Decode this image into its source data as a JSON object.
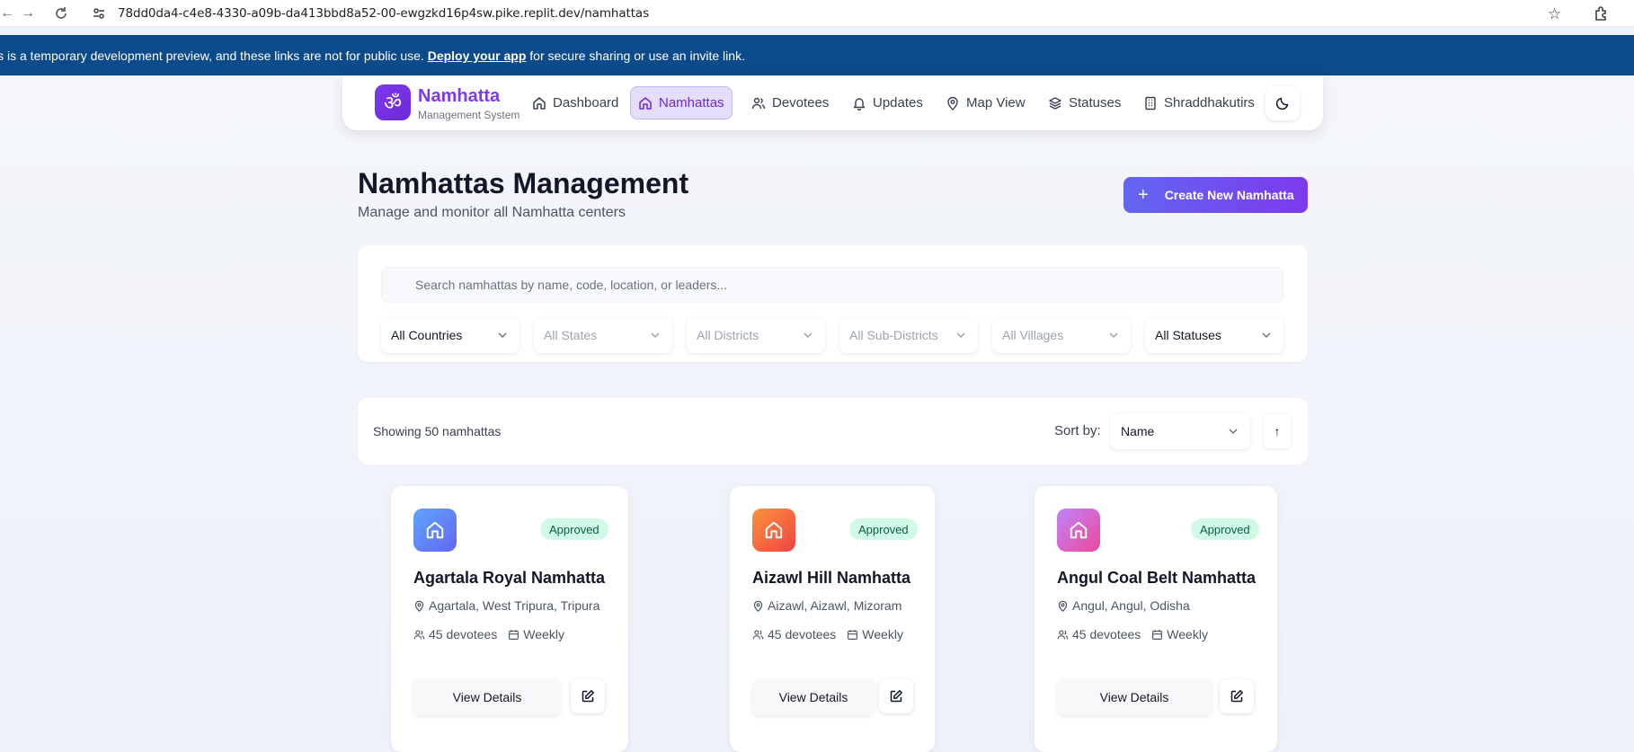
{
  "browser": {
    "url": "78dd0da4-c4e8-4330-a09b-da413bbd8a52-00-ewgzkd16p4sw.pike.replit.dev/namhattas"
  },
  "banner": {
    "text": "is is a temporary development preview, and these links are not for public use.",
    "link": "Deploy your app",
    "suffix": "for secure sharing or use an invite link."
  },
  "brand": {
    "logo_glyph": "ॐ",
    "title": "Namhatta",
    "subtitle": "Management System",
    "accent_color": "#7c3aed"
  },
  "nav": {
    "items": [
      {
        "label": "Dashboard",
        "icon": "home-icon"
      },
      {
        "label": "Namhattas",
        "icon": "home-icon",
        "active": true
      },
      {
        "label": "Devotees",
        "icon": "users-icon"
      },
      {
        "label": "Updates",
        "icon": "bell-icon"
      },
      {
        "label": "Map View",
        "icon": "map-pin-icon"
      },
      {
        "label": "Statuses",
        "icon": "layers-icon"
      },
      {
        "label": "Shraddhakutirs",
        "icon": "building-icon"
      }
    ],
    "theme_toggle_icon": "moon-icon"
  },
  "page": {
    "title": "Namhattas Management",
    "subtitle": "Manage and monitor all Namhatta centers",
    "create_button": "Create New Namhatta"
  },
  "filters": {
    "search_placeholder": "Search namhattas by name, code, location, or leaders...",
    "selects": [
      {
        "label": "All Countries",
        "enabled": true
      },
      {
        "label": "All States",
        "enabled": false
      },
      {
        "label": "All Districts",
        "enabled": false
      },
      {
        "label": "All Sub-Districts",
        "enabled": false
      },
      {
        "label": "All Villages",
        "enabled": false
      },
      {
        "label": "All Statuses",
        "enabled": true
      }
    ]
  },
  "results": {
    "count_text": "Showing 50 namhattas",
    "sort_label": "Sort by:",
    "sort_value": "Name",
    "sort_direction": "↑"
  },
  "cards": [
    {
      "name": "Agartala Royal Namhatta",
      "status": "Approved",
      "location": "Agartala, West Tripura, Tripura",
      "devotees": "45 devotees",
      "frequency": "Weekly",
      "view_label": "View Details",
      "icon_gradient": [
        "#60a5fa",
        "#6366f1"
      ]
    },
    {
      "name": "Aizawl Hill Namhatta",
      "status": "Approved",
      "location": "Aizawl, Aizawl, Mizoram",
      "devotees": "45 devotees",
      "frequency": "Weekly",
      "view_label": "View Details",
      "icon_gradient": [
        "#fb923c",
        "#ef4444"
      ]
    },
    {
      "name": "Angul Coal Belt Namhatta",
      "status": "Approved",
      "location": "Angul, Angul, Odisha",
      "devotees": "45 devotees",
      "frequency": "Weekly",
      "view_label": "View Details",
      "icon_gradient": [
        "#c084fc",
        "#ec4899"
      ]
    }
  ]
}
